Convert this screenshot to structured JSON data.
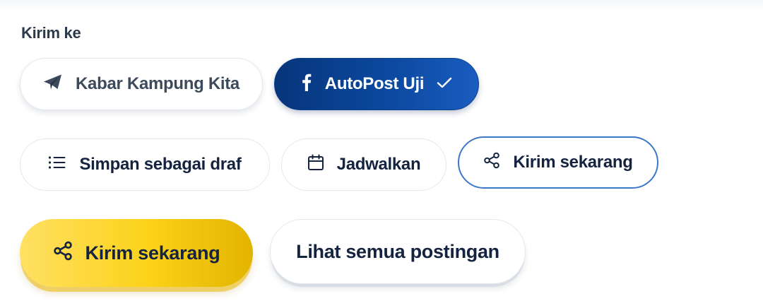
{
  "send_to": {
    "label": "Kirim ke",
    "destinations": [
      {
        "label": "Kabar Kampung Kita",
        "icon": "telegram-send-icon",
        "selected": false
      },
      {
        "label": "AutoPost Uji",
        "icon": "facebook-icon",
        "selected": true,
        "check_icon": "checkmark-icon"
      }
    ]
  },
  "actions": [
    {
      "label": "Simpan sebagai draf",
      "icon": "list-icon"
    },
    {
      "label": "Jadwalkan",
      "icon": "calendar-icon"
    },
    {
      "label": "Kirim sekarang",
      "icon": "share-icon",
      "selected": true
    }
  ],
  "footer": {
    "primary_button": {
      "label": "Kirim sekarang",
      "icon": "share-icon"
    },
    "secondary_button": {
      "label": "Lihat semua postingan"
    }
  },
  "colors": {
    "facebook_pill": "#0c4aa2",
    "primary_button": "#fcd21a",
    "selected_border": "#3d78c8",
    "text_dark": "#14233f"
  }
}
